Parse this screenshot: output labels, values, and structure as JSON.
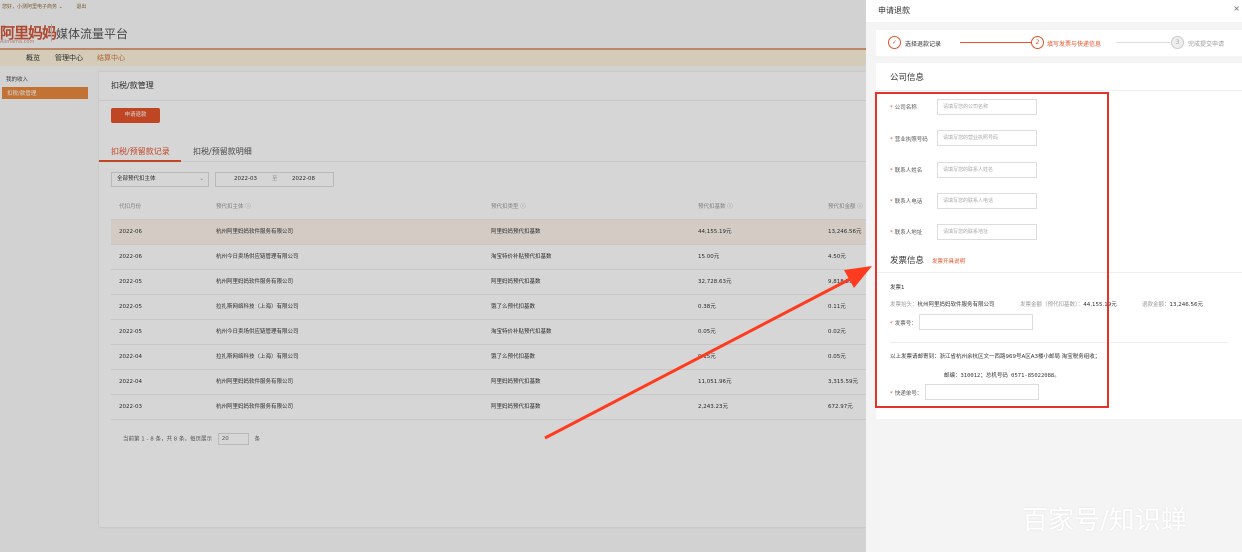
{
  "topbar": {
    "greeting": "您好，小测阿里电子商务",
    "dropdown": "⌄",
    "logout": "退出"
  },
  "logo": {
    "main": "阿里妈妈",
    "sub": "Alimama.com",
    "platform": "媒体流量平台"
  },
  "nav": {
    "items": [
      "概览",
      "管理中心",
      "结算中心"
    ]
  },
  "sidebar": {
    "title": "我的收入",
    "active_item": "扣税/款管理"
  },
  "main": {
    "title": "扣税/款管理",
    "apply_button": "申请退款",
    "tabs": [
      "扣税/预留款记录",
      "扣税/预留款明细"
    ],
    "filter": {
      "subject": "全部预代扣主体",
      "date_from": "2022-03",
      "date_sep": "至",
      "date_to": "2022-08"
    },
    "table": {
      "headers": [
        "代扣月份",
        "预代扣主体 ⓘ",
        "预代扣类型 ⓘ",
        "预代扣基数 ⓘ",
        "预代扣金额 ⓘ"
      ],
      "rows": [
        [
          "2022-06",
          "杭州阿里妈妈软件服务有限公司",
          "阿里妈妈预代扣基数",
          "44,155.19元",
          "13,246.56元"
        ],
        [
          "2022-06",
          "杭州今日卖场供应链管理有限公司",
          "淘宝特价补贴预代扣基数",
          "15.00元",
          "4.50元"
        ],
        [
          "2022-05",
          "杭州阿里妈妈软件服务有限公司",
          "阿里妈妈预代扣基数",
          "32,728.63元",
          "9,818.59元"
        ],
        [
          "2022-05",
          "拉扎斯网络科技（上海）有限公司",
          "饿了么预代扣基数",
          "0.38元",
          "0.11元"
        ],
        [
          "2022-05",
          "杭州今日卖场供应链管理有限公司",
          "淘宝特价补贴预代扣基数",
          "0.05元",
          "0.02元"
        ],
        [
          "2022-04",
          "拉扎斯网络科技（上海）有限公司",
          "饿了么预代扣基数",
          "0.15元",
          "0.05元"
        ],
        [
          "2022-04",
          "杭州阿里妈妈软件服务有限公司",
          "阿里妈妈预代扣基数",
          "11,051.96元",
          "3,315.59元"
        ],
        [
          "2022-03",
          "杭州阿里妈妈软件服务有限公司",
          "阿里妈妈预代扣基数",
          "2,243.23元",
          "672.97元"
        ]
      ]
    },
    "pager": {
      "summary": "当前第 1 - 8 条，共 8 条，每页展示",
      "page_size": "20",
      "unit": "条"
    }
  },
  "drawer": {
    "title": "申请退款",
    "close": "×",
    "steps": [
      {
        "num": "✓",
        "label": "选择退款记录"
      },
      {
        "num": "2",
        "label": "填写发票与快递信息"
      },
      {
        "num": "3",
        "label": "完成提交申请"
      }
    ],
    "company_section": "公司信息",
    "fields": [
      {
        "label": "公司名称",
        "placeholder": "请填写您的公司名称"
      },
      {
        "label": "营业执照号码",
        "placeholder": "请填写您的营业执照号码"
      },
      {
        "label": "联系人姓名",
        "placeholder": "请填写您的联系人姓名"
      },
      {
        "label": "联系人电话",
        "placeholder": "请填写您的联系人电话"
      },
      {
        "label": "联系人地址",
        "placeholder": "请填写您的联系地址"
      }
    ],
    "invoice_section": "发票信息",
    "invoice_link": "发票开具说明",
    "invoice": {
      "name": "发票1",
      "title_key": "发票抬头：",
      "title_val": "杭州阿里妈妈软件服务有限公司",
      "amount_key": "发票金额（预代扣基数）：",
      "amount_val": "44,155.19元",
      "refund_key": "退款金额：",
      "refund_val": "13,246.56元",
      "no_label": "发票号："
    },
    "mail_address": "以上发票请邮寄到：浙江省杭州余杭区文一西路969号A区A3楼小邮局  淘宝税务组收；",
    "mail_postcode": "邮编：310012；总机号码 0571-85022088。",
    "express_label": "快递单号："
  },
  "watermark": "百家号/知识蝉",
  "colors": {
    "accent": "#e5532a",
    "annotation": "#e5332a"
  }
}
